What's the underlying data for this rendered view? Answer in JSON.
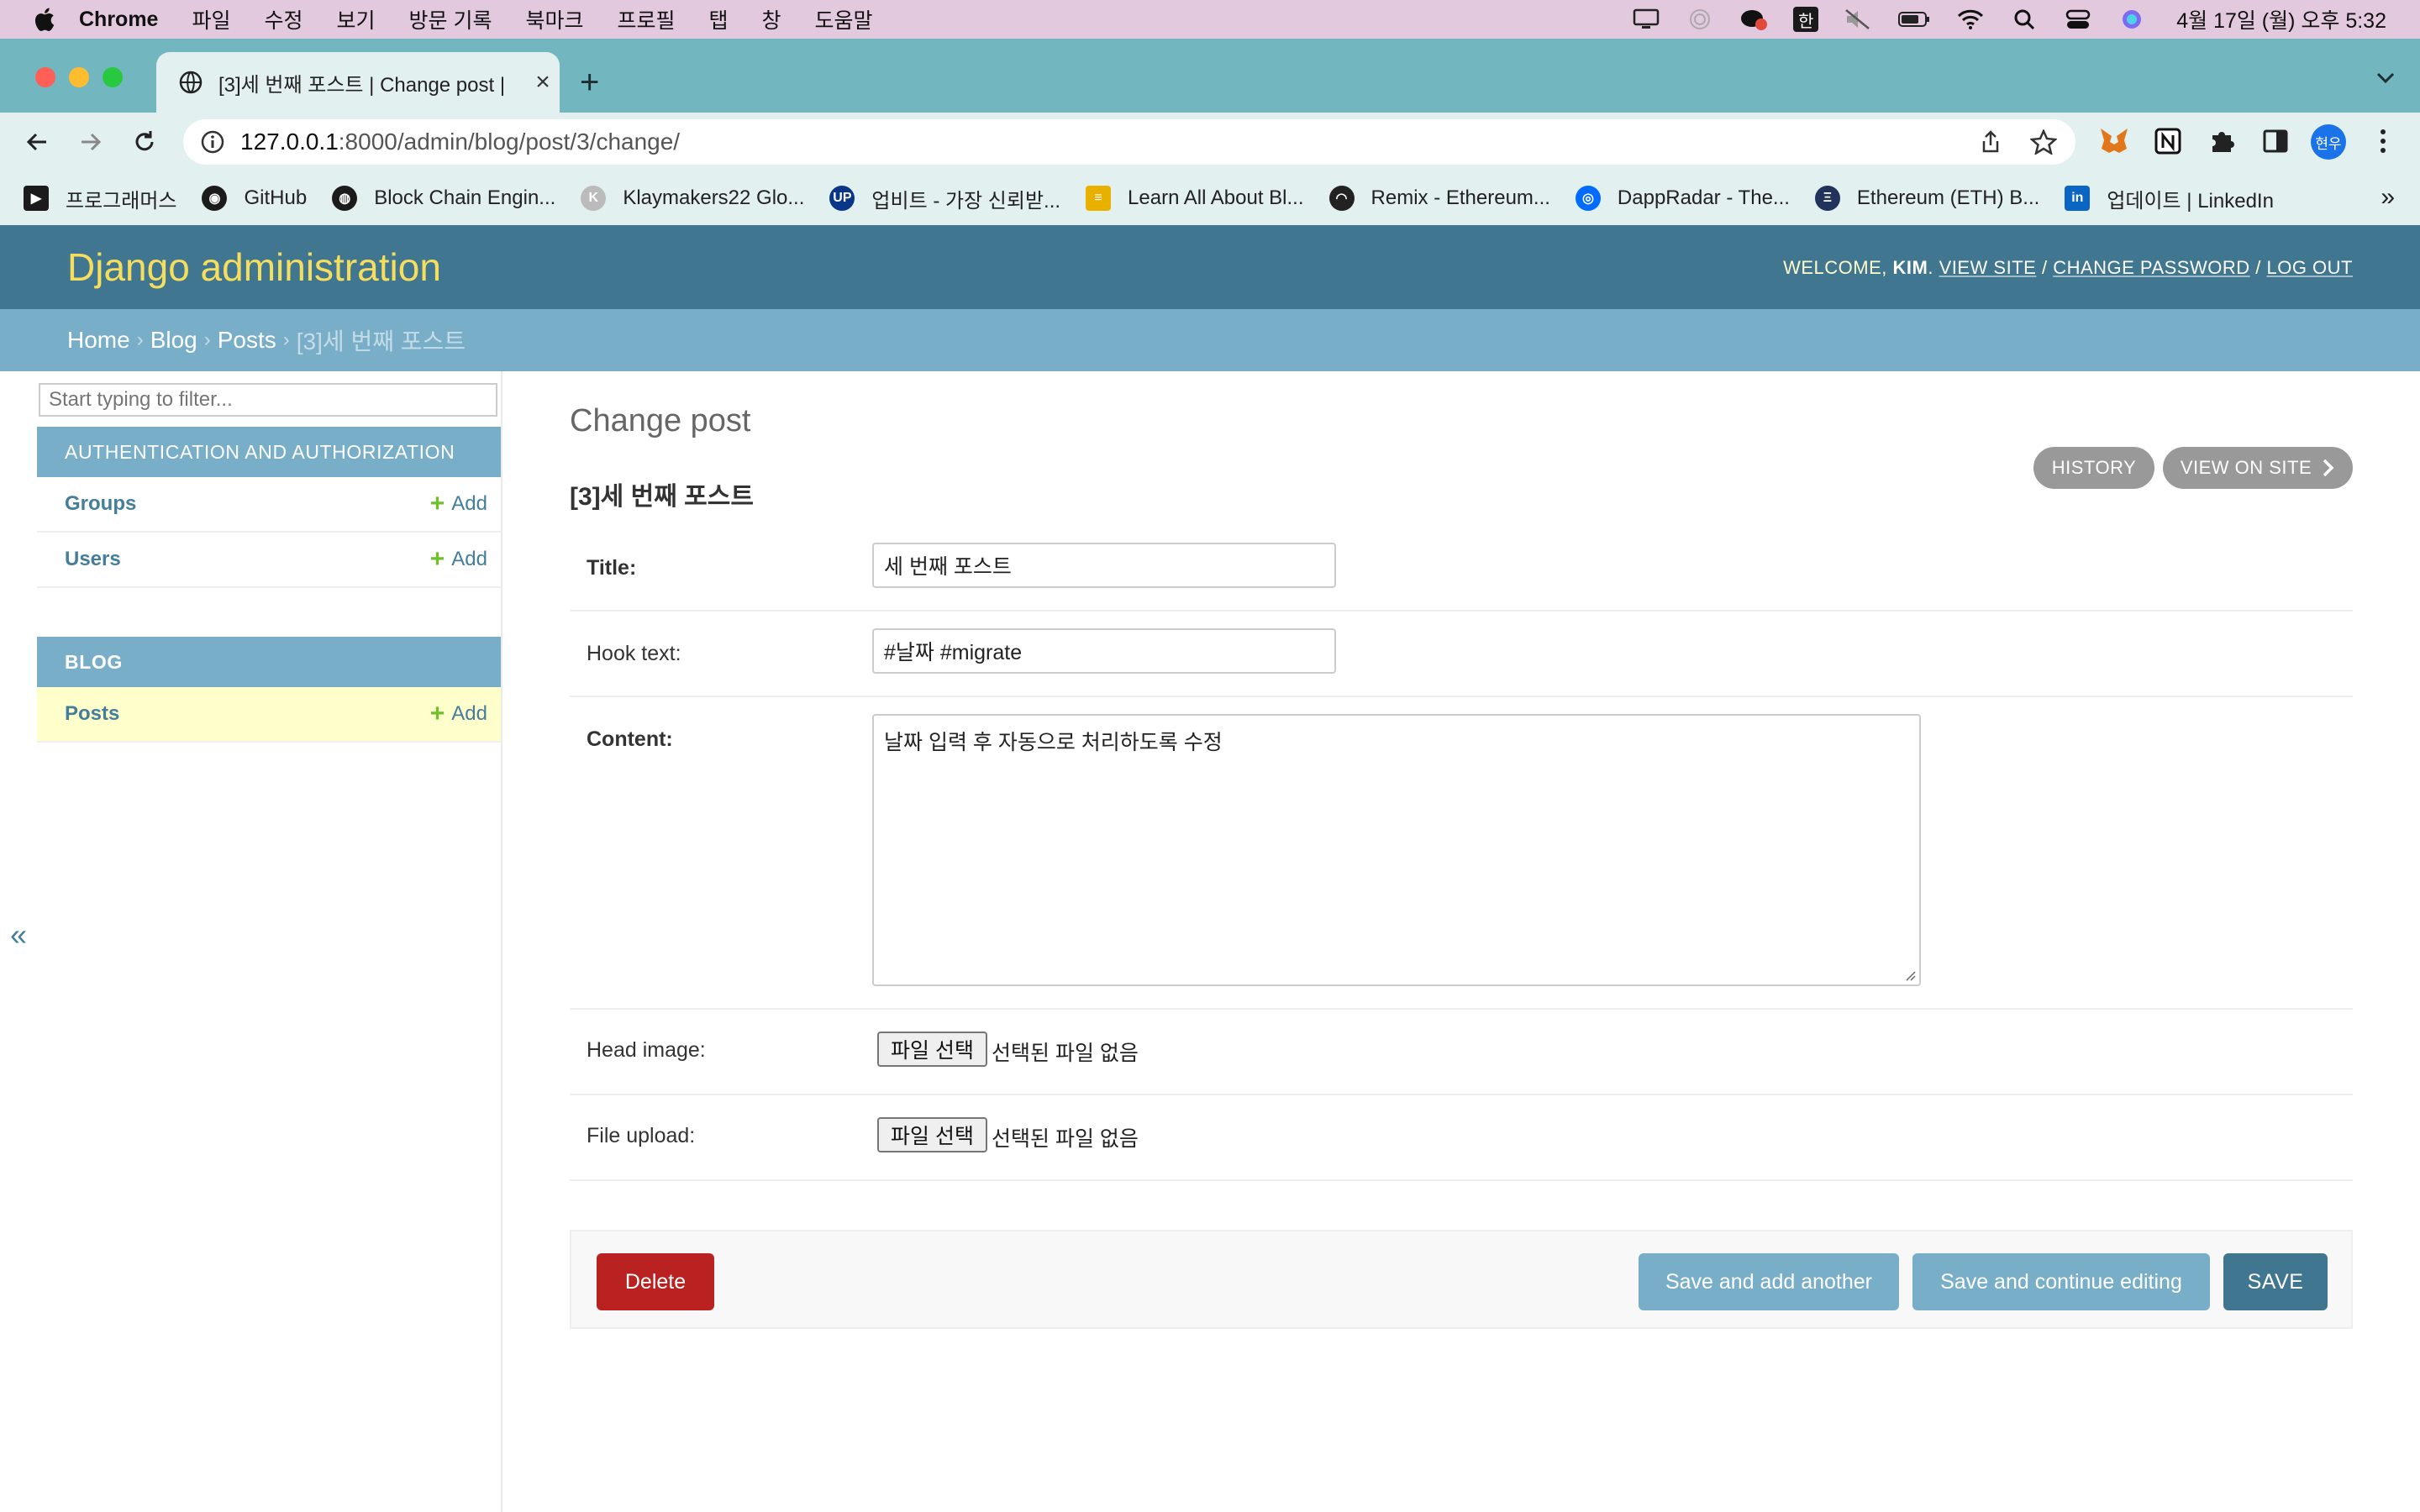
{
  "menubar": {
    "app_name": "Chrome",
    "items": [
      "파일",
      "수정",
      "보기",
      "방문 기록",
      "북마크",
      "프로필",
      "탭",
      "창",
      "도움말"
    ],
    "han_label": "한",
    "clock": "4월 17일 (월) 오후 5:32"
  },
  "browser": {
    "tab_title": "[3]세 번째 포스트 | Change post |",
    "url_host": "127.0.0.1",
    "url_path": ":8000/admin/blog/post/3/change/",
    "profile_label": "현우",
    "bookmarks": [
      {
        "label": "프로그래머스",
        "icon": "programmers-icon",
        "color": "#1b1b1b"
      },
      {
        "label": "GitHub",
        "icon": "github-icon",
        "color": "#1b1b1b"
      },
      {
        "label": "Block Chain Engin...",
        "icon": "globe-icon",
        "color": "#1b1b1b"
      },
      {
        "label": "Klaymakers22 Glo...",
        "icon": "klaymakers-icon",
        "color": "#bbbbbb"
      },
      {
        "label": "업비트 - 가장 신뢰받...",
        "icon": "upbit-icon",
        "color": "#093687"
      },
      {
        "label": "Learn All About Bl...",
        "icon": "learn-icon",
        "color": "#e8b100"
      },
      {
        "label": "Remix - Ethereum...",
        "icon": "remix-icon",
        "color": "#222222"
      },
      {
        "label": "DappRadar - The...",
        "icon": "dappradar-icon",
        "color": "#006cff"
      },
      {
        "label": "Ethereum (ETH) B...",
        "icon": "ethereum-icon",
        "color": "#21325b"
      },
      {
        "label": "업데이트 | LinkedIn",
        "icon": "linkedin-icon",
        "color": "#0a66c2"
      }
    ],
    "bookmarks_more": "»"
  },
  "header": {
    "site_name": "Django administration",
    "welcome": "Welcome,",
    "username": "kim",
    "view_site": "View site",
    "change_password": "Change password",
    "log_out": "Log out"
  },
  "breadcrumbs": {
    "home": "Home",
    "app": "Blog",
    "model": "Posts",
    "current": "[3]세 번째 포스트",
    "separator": "›"
  },
  "sidebar": {
    "filter_placeholder": "Start typing to filter...",
    "apps": [
      {
        "caption": "AUTHENTICATION AND AUTHORIZATION",
        "models": [
          {
            "name": "Groups",
            "add": "Add"
          },
          {
            "name": "Users",
            "add": "Add"
          }
        ]
      },
      {
        "caption": "BLOG",
        "models": [
          {
            "name": "Posts",
            "add": "Add"
          }
        ]
      }
    ],
    "toggle": "«"
  },
  "content": {
    "title": "Change post",
    "object_title": "[3]세 번째 포스트",
    "history_button": "History",
    "view_on_site_button": "View on site",
    "fields": {
      "title": {
        "label": "Title:",
        "value": "세 번째 포스트"
      },
      "hook_text": {
        "label": "Hook text:",
        "value": "#날짜 #migrate"
      },
      "content": {
        "label": "Content:",
        "value": "날짜 입력 후 자동으로 처리하도록 수정"
      },
      "head_image": {
        "label": "Head image:",
        "button": "파일 선택",
        "status": "선택된 파일 없음"
      },
      "file_upload": {
        "label": "File upload:",
        "button": "파일 선택",
        "status": "선택된 파일 없음"
      }
    },
    "buttons": {
      "delete": "Delete",
      "save_add_another": "Save and add another",
      "save_continue": "Save and continue editing",
      "save": "SAVE"
    }
  },
  "colors": {
    "header_bg": "#417690",
    "breadcrumbs_bg": "#79aec8",
    "site_name": "#f5dd5d",
    "delete_btn": "#ba2121",
    "tab_strip": "#72b7c0",
    "menubar": "#e3c9dd"
  }
}
